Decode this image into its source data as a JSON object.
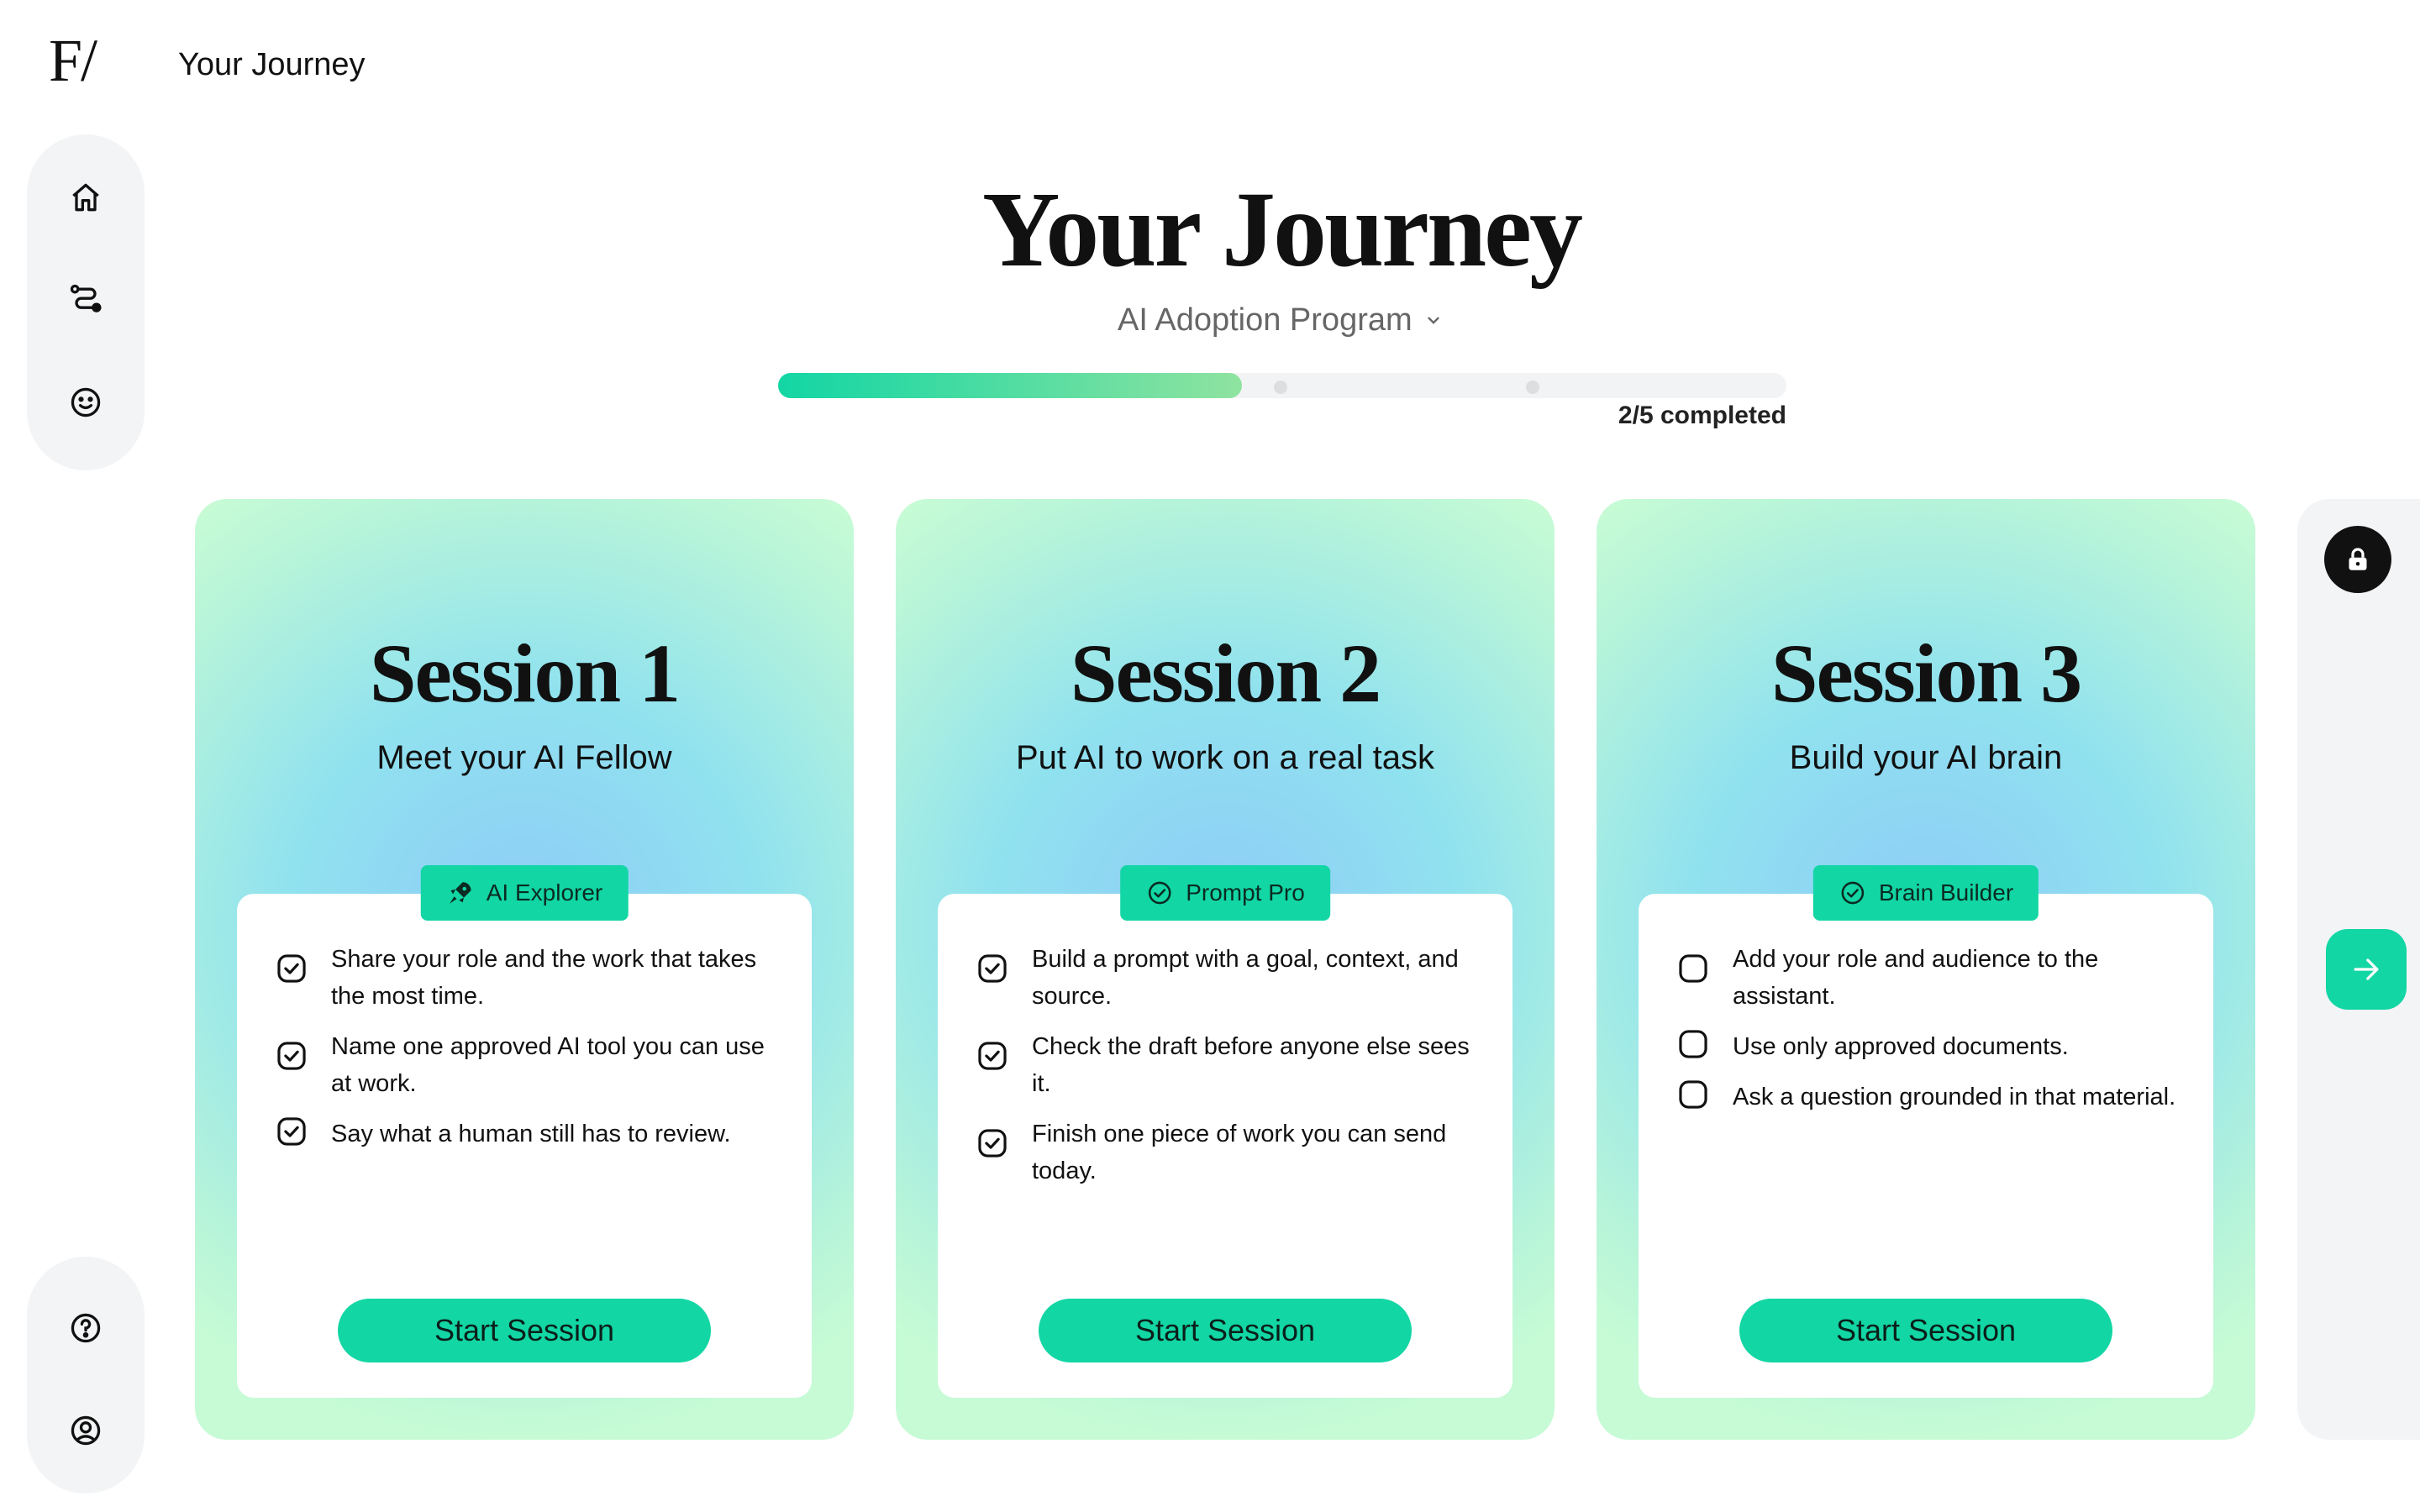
{
  "header": {
    "logo": "F/",
    "title": "Your Journey"
  },
  "sidebar": {
    "top_icons": [
      "home-icon",
      "route-icon",
      "smiley-icon"
    ],
    "bottom_icons": [
      "help-icon",
      "profile-icon"
    ]
  },
  "main": {
    "title": "Your Journey",
    "program": "AI Adoption Program",
    "progress": {
      "completed": 2,
      "total": 5,
      "fraction": 0.4,
      "label": "2/5 completed"
    }
  },
  "sessions": [
    {
      "title": "Session 1",
      "subtitle": "Meet your AI Fellow",
      "badge": {
        "label": "AI Explorer",
        "icon": "rocket-icon"
      },
      "items": [
        {
          "text": "Share your role and the work that takes the most time.",
          "checked": true
        },
        {
          "text": "Name one approved AI tool you can use at work.",
          "checked": true
        },
        {
          "text": "Say what a human still has to review.",
          "checked": true
        }
      ],
      "button": "Start Session"
    },
    {
      "title": "Session 2",
      "subtitle": "Put AI to work on a real task",
      "badge": {
        "label": "Prompt Pro",
        "icon": "check-circle-icon"
      },
      "items": [
        {
          "text": "Build a prompt with a goal, context, and source.",
          "checked": true
        },
        {
          "text": "Check the draft before anyone else sees it.",
          "checked": true
        },
        {
          "text": "Finish one piece of work you can send today.",
          "checked": true
        }
      ],
      "button": "Start Session"
    },
    {
      "title": "Session 3",
      "subtitle": "Build your AI brain",
      "badge": {
        "label": "Brain Builder",
        "icon": "check-circle-icon"
      },
      "items": [
        {
          "text": "Add your role and audience to the assistant.",
          "checked": false
        },
        {
          "text": "Use only approved documents.",
          "checked": false
        },
        {
          "text": "Ask a question grounded in that material.",
          "checked": false
        }
      ],
      "button": "Start Session"
    }
  ],
  "locked_card": {
    "icon": "lock-icon"
  },
  "next_button": {
    "icon": "arrow-right-icon"
  },
  "colors": {
    "accent": "#12d6a4",
    "text": "#111111",
    "muted": "#666666",
    "rail": "#f3f4f5"
  }
}
